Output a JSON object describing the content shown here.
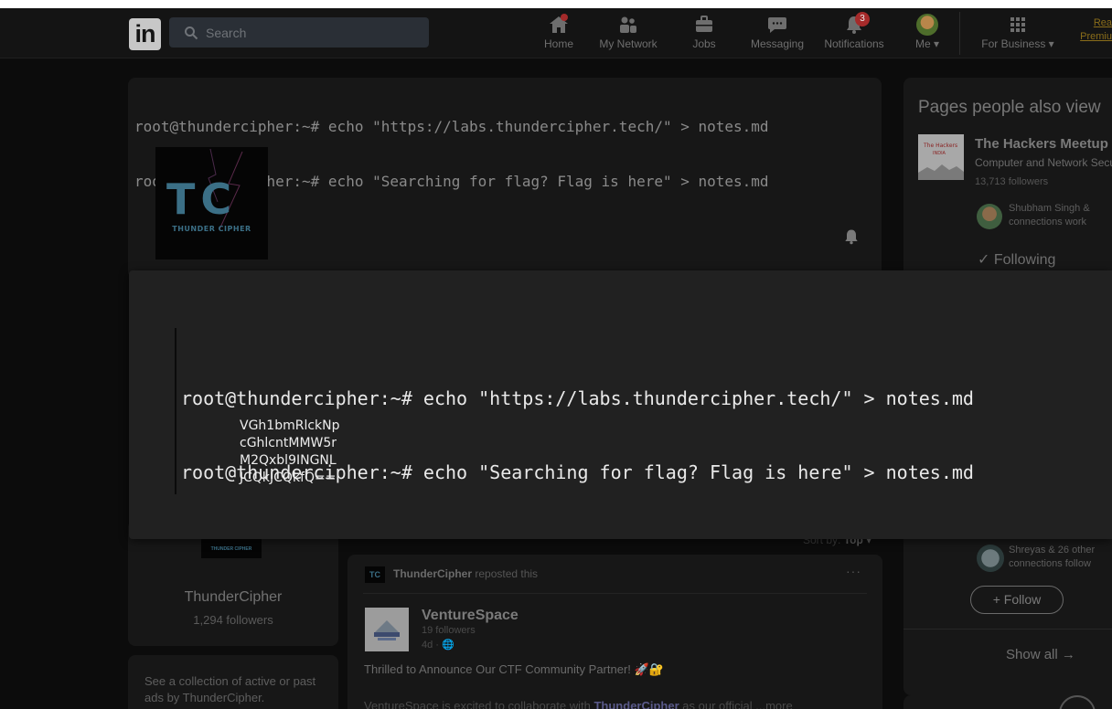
{
  "nav": {
    "logo": "in",
    "search_placeholder": "Search",
    "items": [
      {
        "label": "Home",
        "icon": "home-icon"
      },
      {
        "label": "My Network",
        "icon": "network-icon"
      },
      {
        "label": "Jobs",
        "icon": "briefcase-icon"
      },
      {
        "label": "Messaging",
        "icon": "chat-icon"
      },
      {
        "label": "Notifications",
        "icon": "bell-icon",
        "badge": "3"
      },
      {
        "label": "Me",
        "icon": "avatar"
      },
      {
        "label": "For Business",
        "icon": "grid-icon"
      }
    ],
    "premium_line1": "Rea",
    "premium_line2": "Premiu"
  },
  "terminal_bg": {
    "line1": "root@thundercipher:~# echo \"https://labs.thundercipher.tech/\" > notes.md",
    "line2": "root@thundercipher:~# echo \"Searching for flag? Flag is here\" > notes.md"
  },
  "overlay": {
    "line1": "root@thundercipher:~# echo \"https://labs.thundercipher.tech/\" > notes.md",
    "line2": "root@thundercipher:~# echo \"Searching for flag? Flag is here\" > notes.md",
    "code": [
      "VGh1bmRlckNp",
      "cGhlcntMMW5r",
      "M2Qxbl9INGNL",
      "JCQkJCQkfQ=="
    ]
  },
  "company": {
    "logo_big": "TC",
    "logo_small": "THUNDER CIPHER",
    "name": "ThunderCipher",
    "followers": "1,294 followers",
    "ads_text": "See a collection of active or past ads by ThunderCipher."
  },
  "right_panel": {
    "title": "Pages people also view",
    "page_name": "The Hackers Meetup",
    "page_sub": "Computer and Network Security",
    "page_followers": "13,713 followers",
    "connections_line1": "Shubham Singh &",
    "connections_line2": "connections work",
    "following": "✓ Following",
    "connections2_line1": "Shreyas & 26 other",
    "connections2_line2": "connections follow",
    "follow_button": "+ Follow",
    "show_all": "Show all →"
  },
  "feed": {
    "sort_label": "Sort by:",
    "sort_value": "Top ▾",
    "reposter": "ThunderCipher",
    "reposted_text": "reposted this",
    "more": "···",
    "author": "VentureSpace",
    "author_followers": "19 followers",
    "author_time": "4d · 🌐",
    "post_line1": "Thrilled to Announce Our CTF Community Partner! 🚀🔐",
    "post_line2_a": "VentureSpace is excited to collaborate with ",
    "post_line2_mention": "ThunderCipher",
    "post_line2_b": " as our official ...more"
  }
}
